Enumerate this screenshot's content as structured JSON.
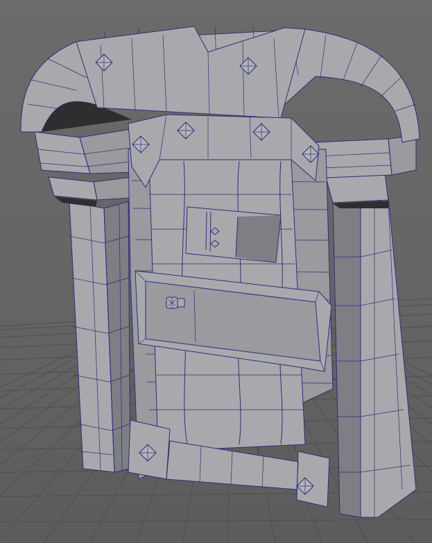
{
  "viewport": {
    "background_color": "#666666",
    "wireframe_color": "#2c2c7a",
    "surface_color": "#a9a9ad",
    "shading_mode": "smooth-shade-with-wireframe"
  },
  "model": {
    "type": "stone-archway-door",
    "stud_count": 8,
    "door_lock_icon": "padlock-icon"
  },
  "grid": {
    "visible": true
  }
}
